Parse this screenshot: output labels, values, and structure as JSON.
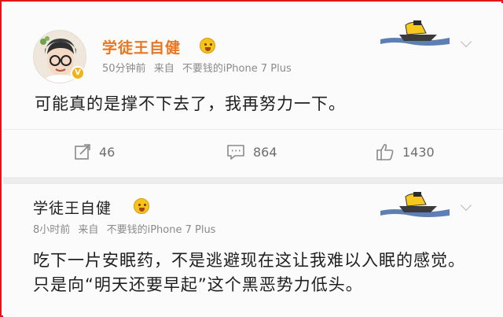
{
  "post1": {
    "author": "学徒王自健",
    "time": "50分钟前",
    "source_prefix": "来自",
    "source": "不要钱的iPhone 7 Plus",
    "content": "可能真的是撑不下去了，我再努力一下。",
    "actions": {
      "repost_count": "46",
      "comment_count": "864",
      "like_count": "1430"
    }
  },
  "post2": {
    "author": "学徒王自健",
    "time": "8小时前",
    "source_prefix": "来自",
    "source": "不要钱的iPhone 7 Plus",
    "content": "吃下一片安眠药，不是逃避现在这让我难以入眠的感觉。只是向“明天还要早起”这个黑恶势力低头。"
  },
  "colors": {
    "author_highlight": "#e8771f",
    "frame_border": "#e0161b",
    "meta_gray": "#8a8a8a"
  },
  "icons": [
    "avatar",
    "verified-badge",
    "face-emoji-icon",
    "boat-decoration-icon",
    "chevron-down-icon",
    "repost-icon",
    "comment-icon",
    "like-icon"
  ]
}
